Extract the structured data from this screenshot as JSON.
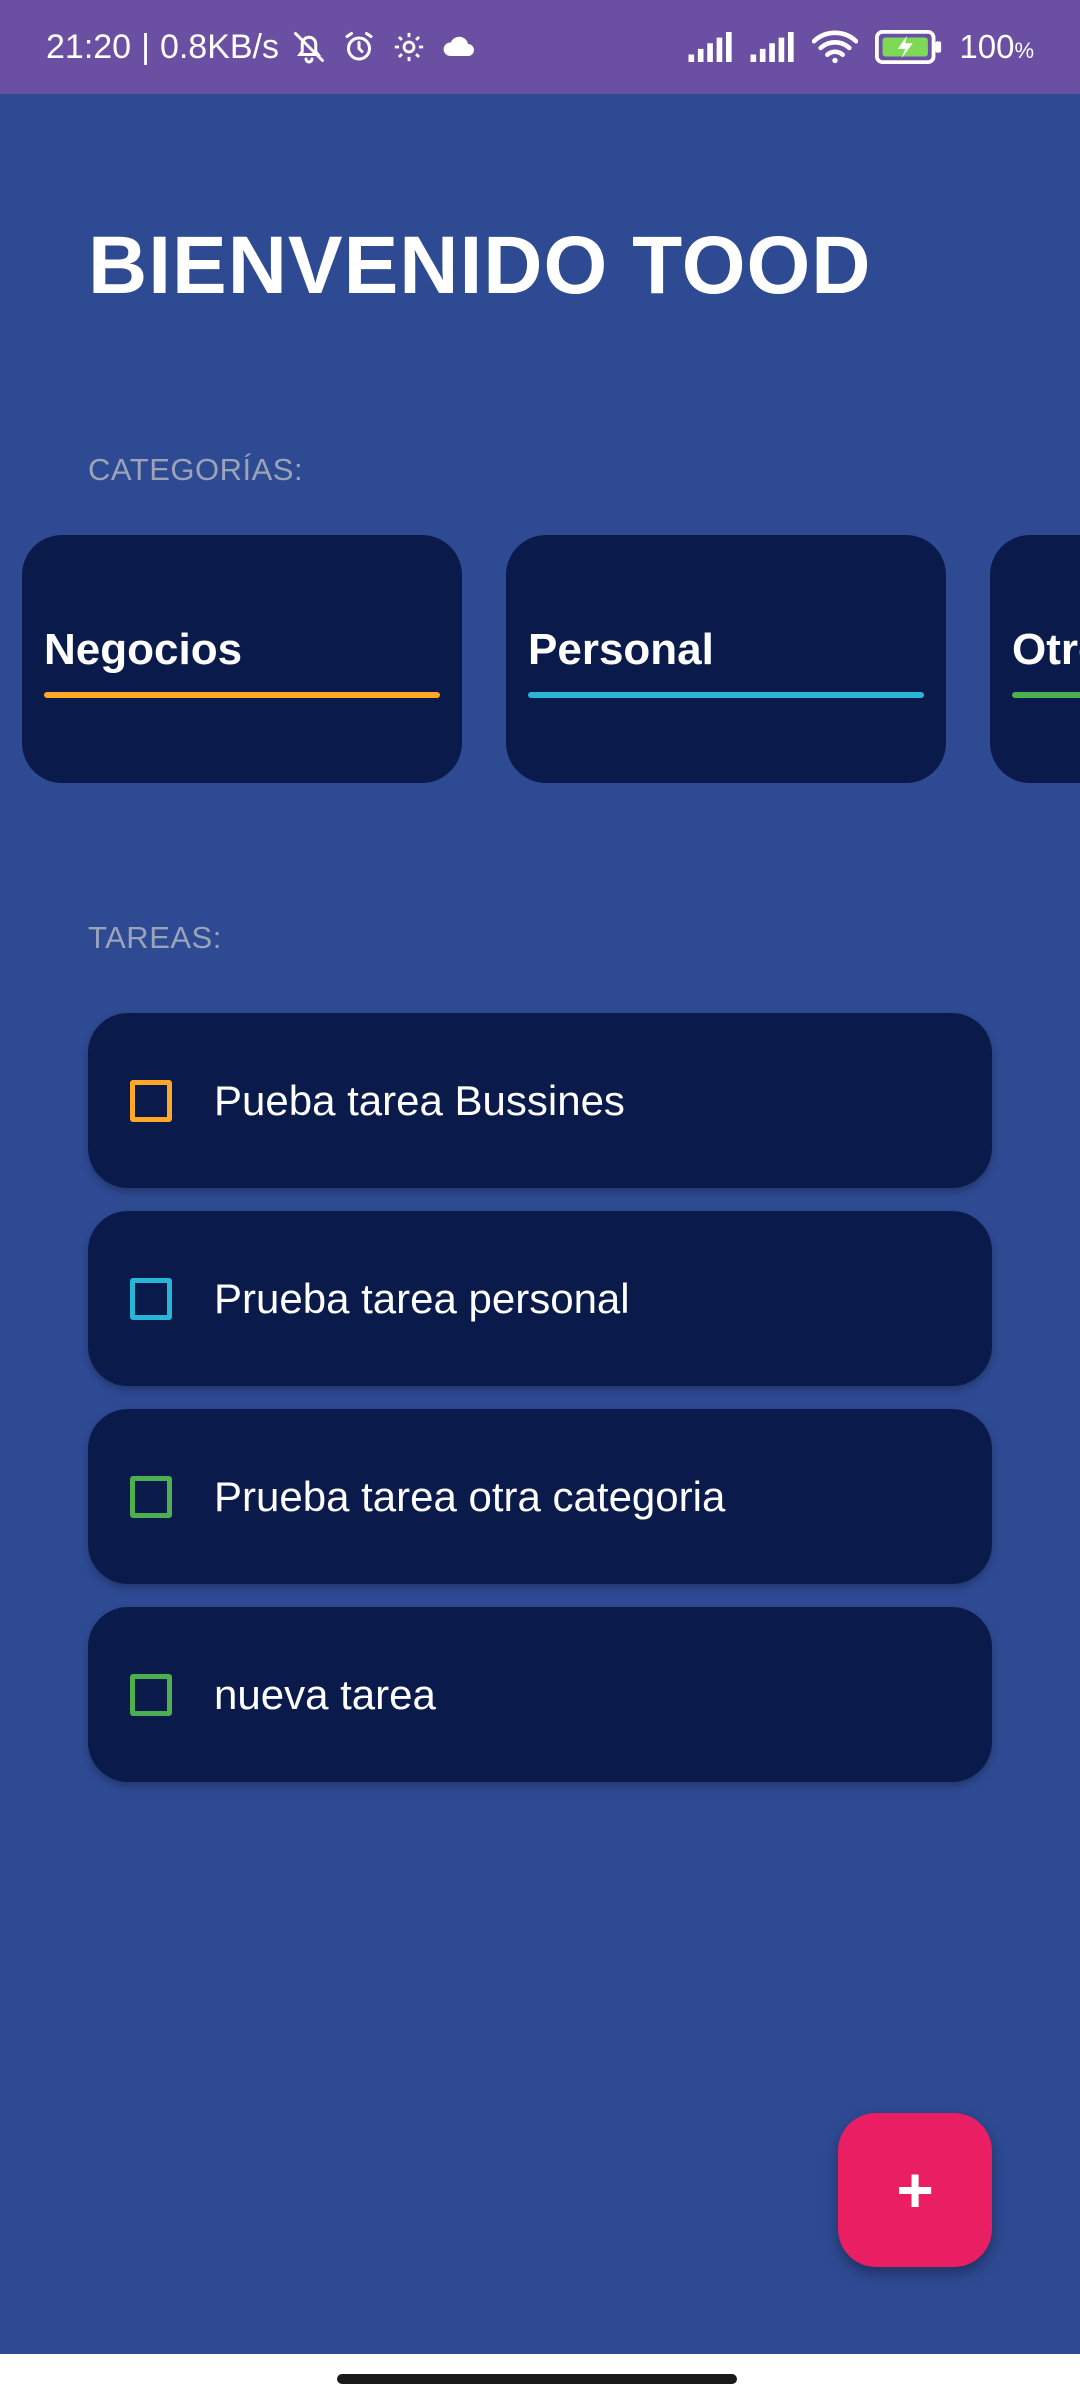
{
  "status_bar": {
    "time": "21:20",
    "separator": "|",
    "speed": "0.8KB/s",
    "icons_left": [
      "bell-off-icon",
      "alarm-icon",
      "settings-icon",
      "cloud-icon"
    ],
    "icons_right": [
      "signal-icon",
      "signal-icon",
      "wifi-icon",
      "battery-charging-icon"
    ],
    "battery": "100",
    "battery_unit": "%"
  },
  "header": {
    "title": "BIENVENIDO TOOD"
  },
  "categories": {
    "label": "CATEGORÍAS:",
    "items": [
      {
        "name": "Negocios",
        "color": "#ffa726"
      },
      {
        "name": "Personal",
        "color": "#29b6d6"
      },
      {
        "name": "Otros",
        "color": "#4caf50"
      }
    ]
  },
  "tasks": {
    "label": "TAREAS:",
    "items": [
      {
        "text": "Pueba tarea Bussines",
        "color": "#ffa726",
        "checked": false
      },
      {
        "text": "Prueba tarea personal",
        "color": "#29b6d6",
        "checked": false
      },
      {
        "text": "Prueba tarea otra categoria",
        "color": "#4caf50",
        "checked": false
      },
      {
        "text": "nueva tarea",
        "color": "#4caf50",
        "checked": false
      }
    ]
  },
  "fab": {
    "label": "+",
    "icon": "plus-icon",
    "color": "#e91e63"
  },
  "colors": {
    "background": "#2e4a93",
    "card": "#0a1a4a",
    "status_bar": "#6a4fa3"
  }
}
